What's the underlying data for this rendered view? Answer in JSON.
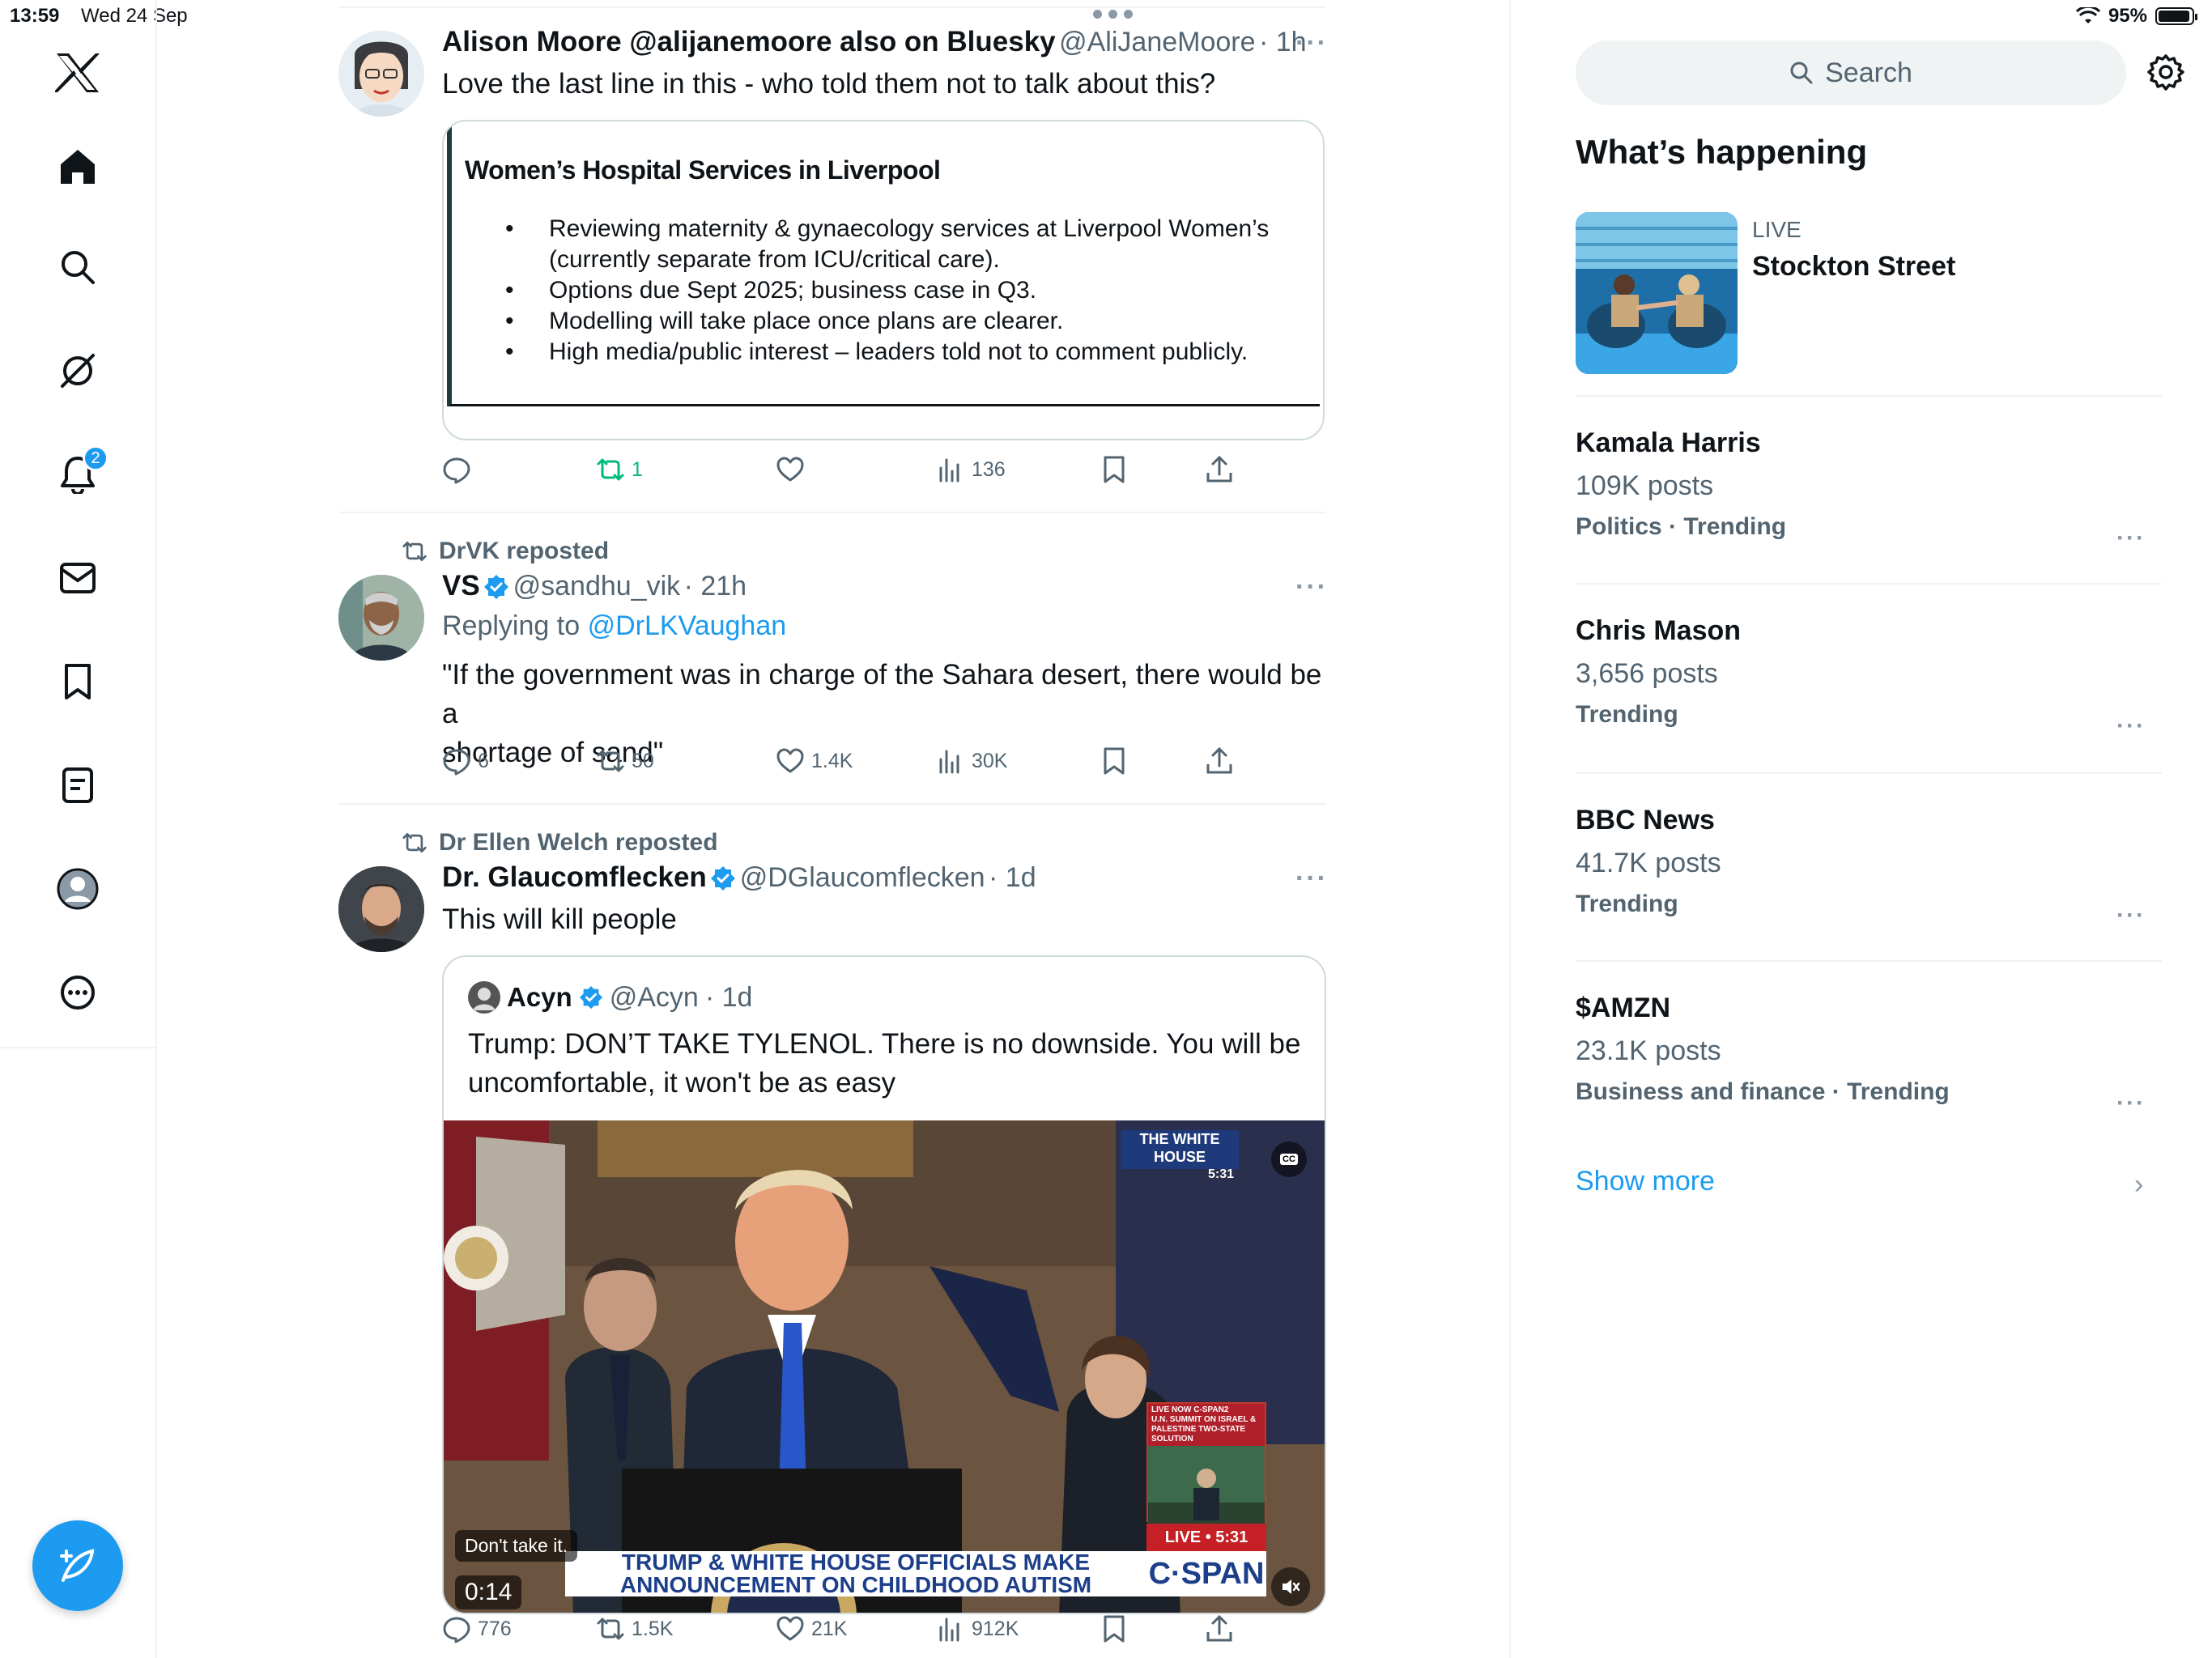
{
  "status_bar": {
    "time": "13:59",
    "date": "Wed 24 Sep",
    "battery": "95%",
    "battery_level": 0.95
  },
  "nav": {
    "notifications_badge": "2",
    "items": [
      "X logo",
      "Home",
      "Explore",
      "Grok",
      "Notifications",
      "Messages",
      "Bookmarks",
      "Lists",
      "Profile",
      "More"
    ]
  },
  "feed": {
    "tweets": [
      {
        "name": "Alison Moore @alijanemoore also on Bluesky",
        "handle": "@AliJaneMoore",
        "time": "· 1h",
        "text": "Love the last line in this - who told them not to talk about this?",
        "card": {
          "title": "Women’s Hospital Services in Liverpool",
          "bullets": [
            "Reviewing maternity & gynaecology services at Liverpool Women’s",
            "(currently separate from ICU/critical care).",
            "Options due Sept 2025; business case in Q3.",
            "Modelling will take place once plans are clearer.",
            "High media/public interest – leaders told not to comment publicly."
          ]
        },
        "actions": {
          "replies": "",
          "reposts": "1",
          "likes": "",
          "views": "136"
        }
      },
      {
        "repost_by": "DrVK reposted",
        "name": "VS",
        "handle": "@sandhu_vik",
        "time": "· 21h",
        "reply_prefix": "Replying to",
        "reply_to": "@DrLKVaughan",
        "text_line1": "\"If the government was in charge of the Sahara desert, there would be a",
        "text_line2": "shortage of sand\"",
        "actions": {
          "replies": "6",
          "reposts": "50",
          "likes": "1.4K",
          "views": "30K"
        }
      },
      {
        "repost_by": "Dr Ellen Welch reposted",
        "name": "Dr. Glaucomflecken",
        "handle": "@DGlaucomflecken",
        "time": "· 1d",
        "text": "This will kill people",
        "quote": {
          "name": "Acyn",
          "handle": "@Acyn",
          "time": "· 1d",
          "text_line1": "Trump: DON’T TAKE TYLENOL. There is no downside. You will be",
          "text_line2": "uncomfortable, it won't be as easy",
          "video": {
            "caption": "Don't take it.",
            "timestamp": "0:14",
            "banner_line1": "TRUMP & WHITE HOUSE OFFICIALS MAKE",
            "banner_line2": "ANNOUNCEMENT ON CHILDHOOD AUTISM",
            "network": "C·SPAN",
            "live": "LIVE • 5:31",
            "corner_tag": "THE WHITE HOUSE",
            "corner_time": "5:31",
            "pip_line1": "LIVE NOW C-SPAN2",
            "pip_line2": "U.N. SUMMIT ON ISRAEL &",
            "pip_line3": "PALESTINE TWO-STATE SOLUTION",
            "cc": "CC"
          }
        },
        "actions": {
          "replies": "776",
          "reposts": "1.5K",
          "likes": "21K",
          "views": "912K"
        }
      }
    ]
  },
  "sidebar": {
    "search_placeholder": "Search",
    "section_title": "What’s happening",
    "live": {
      "label": "LIVE",
      "title": "Stockton Street"
    },
    "trends": [
      {
        "name": "Kamala Harris",
        "posts": "109K posts",
        "category": "Politics · Trending"
      },
      {
        "name": "Chris Mason",
        "posts": "3,656 posts",
        "category": "Trending"
      },
      {
        "name": "BBC News",
        "posts": "41.7K posts",
        "category": "Trending"
      },
      {
        "name": "$AMZN",
        "posts": "23.1K posts",
        "category": "Business and finance · Trending"
      }
    ],
    "show_more": "Show more"
  },
  "colors": {
    "accent": "#1d9bf0",
    "text": "#0f1419",
    "secondary": "#536471",
    "repost_green": "#00ba7c"
  }
}
